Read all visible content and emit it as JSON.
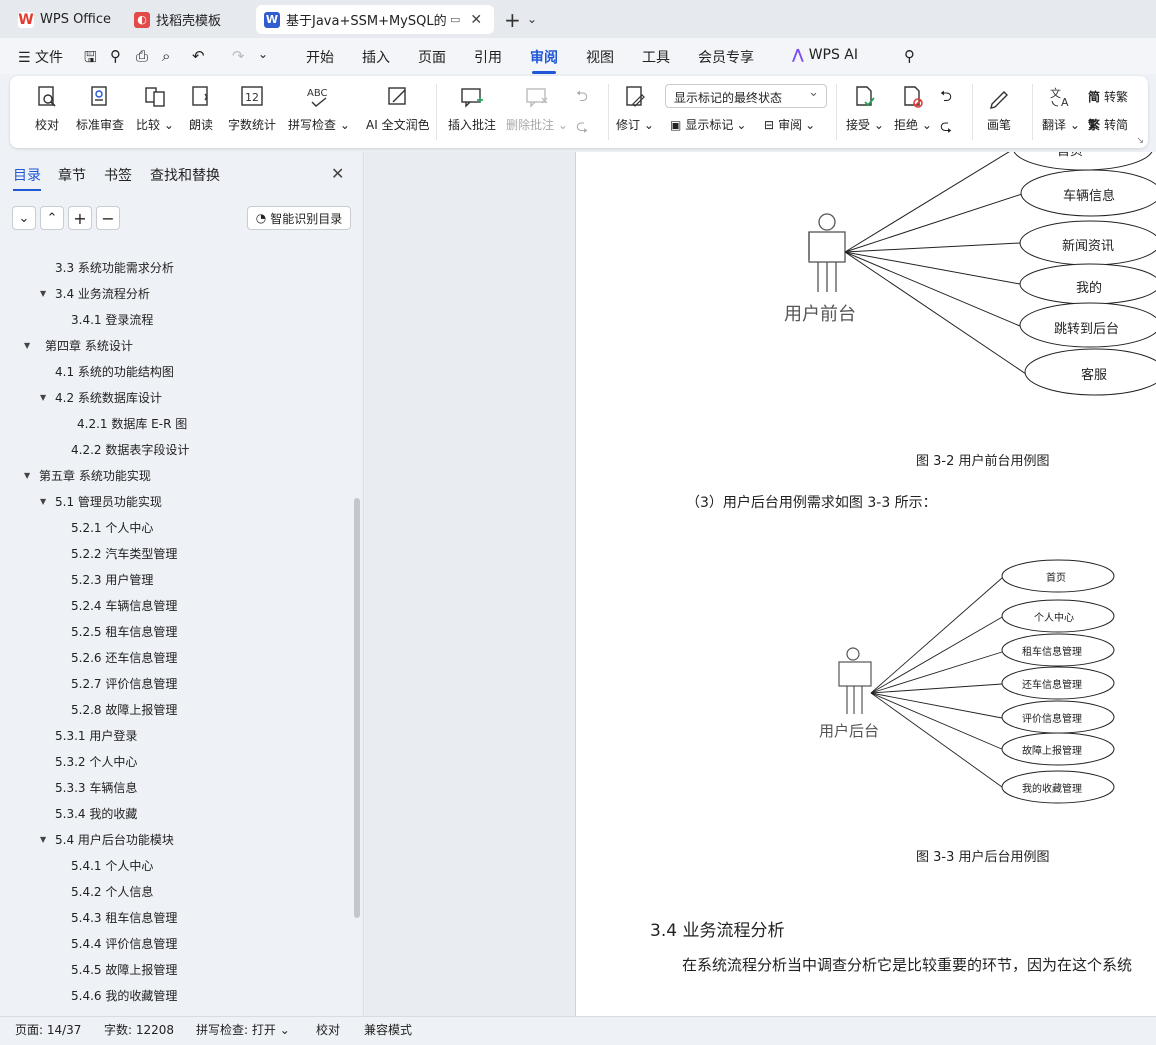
{
  "tabs": [
    {
      "label": "WPS Office"
    },
    {
      "label": "找稻壳模板"
    },
    {
      "label": "基于Java+SSM+MySQL的网"
    }
  ],
  "menu": {
    "file": "文件",
    "items": [
      "开始",
      "插入",
      "页面",
      "引用",
      "审阅",
      "视图",
      "工具",
      "会员专享"
    ],
    "ai": "WPS AI"
  },
  "ribbon": {
    "proofread": "校对",
    "std_review": "标准审查",
    "compare": "比较",
    "read_aloud": "朗读",
    "word_count": "字数统计",
    "spell_check": "拼写检查",
    "ai_polish": "AI 全文润色",
    "insert_comment": "插入批注",
    "delete_comment": "删除批注",
    "revise": "修订",
    "markup_state": "显示标记的最终状态",
    "show_markup": "显示标记",
    "review": "审阅",
    "accept": "接受",
    "reject": "拒绝",
    "pen": "画笔",
    "translate": "翻译",
    "to_traditional": "转繁",
    "to_simplified": "转简",
    "spell_icon_text": "ABC",
    "count_icon_text": "12"
  },
  "sidebar": {
    "tabs": [
      "目录",
      "章节",
      "书签",
      "查找和替换"
    ],
    "smart_btn": "智能识别目录",
    "toc": [
      {
        "label": "3.3  系统功能需求分析"
      },
      {
        "label": "3.4  业务流程分析"
      },
      {
        "label": "3.4.1 登录流程"
      },
      {
        "label": "第四章  系统设计"
      },
      {
        "label": "4.1  系统的功能结构图"
      },
      {
        "label": "4.2  系统数据库设计"
      },
      {
        "label": "4.2.1    数据库 E-R 图"
      },
      {
        "label": "4.2.2    数据表字段设计"
      },
      {
        "label": "第五章  系统功能实现"
      },
      {
        "label": "5.1 管理员功能实现"
      },
      {
        "label": "5.2.1  个人中心"
      },
      {
        "label": "5.2.2  汽车类型管理"
      },
      {
        "label": "5.2.3 用户管理"
      },
      {
        "label": "5.2.4  车辆信息管理"
      },
      {
        "label": "5.2.5  租车信息管理"
      },
      {
        "label": "5.2.6 还车信息管理"
      },
      {
        "label": "5.2.7  评价信息管理"
      },
      {
        "label": "5.2.8  故障上报管理"
      },
      {
        "label": "5.3.1 用户登录"
      },
      {
        "label": "5.3.2 个人中心"
      },
      {
        "label": "5.3.3 车辆信息"
      },
      {
        "label": "5.3.4 我的收藏"
      },
      {
        "label": "5.4 用户后台功能模块"
      },
      {
        "label": "5.4.1 个人中心"
      },
      {
        "label": "5.4.2 个人信息"
      },
      {
        "label": "5.4.3 租车信息管理"
      },
      {
        "label": "5.4.4 评价信息管理"
      },
      {
        "label": "5.4.5 故障上报管理"
      },
      {
        "label": "5.4.6 我的收藏管理"
      }
    ]
  },
  "doc": {
    "fig1": {
      "actor": "用户前台",
      "cases": [
        "首页",
        "车辆信息",
        "新闻资讯",
        "我的",
        "跳转到后台",
        "客服"
      ],
      "caption": "图 3-2 用户前台用例图"
    },
    "para1": "（3）用户后台用例需求如图 3-3 所示：",
    "fig2": {
      "actor": "用户后台",
      "cases": [
        "首页",
        "个人中心",
        "租车信息管理",
        "还车信息管理",
        "评价信息管理",
        "故障上报管理",
        "我的收藏管理"
      ],
      "caption": "图 3-3 用户后台用例图"
    },
    "heading": "3.4  业务流程分析",
    "para2": "在系统流程分析当中调查分析它是比较重要的环节，因为在这个系统"
  },
  "status": {
    "page": "页面: 14/37",
    "words": "字数: 12208",
    "spell": "拼写检查: 打开",
    "proof": "校对",
    "compat": "兼容模式"
  },
  "colors": {
    "accent": "#2158d6",
    "wps_red": "#e53a2f",
    "docer_red": "#e24a4a",
    "word_blue": "#2f5cd0"
  }
}
